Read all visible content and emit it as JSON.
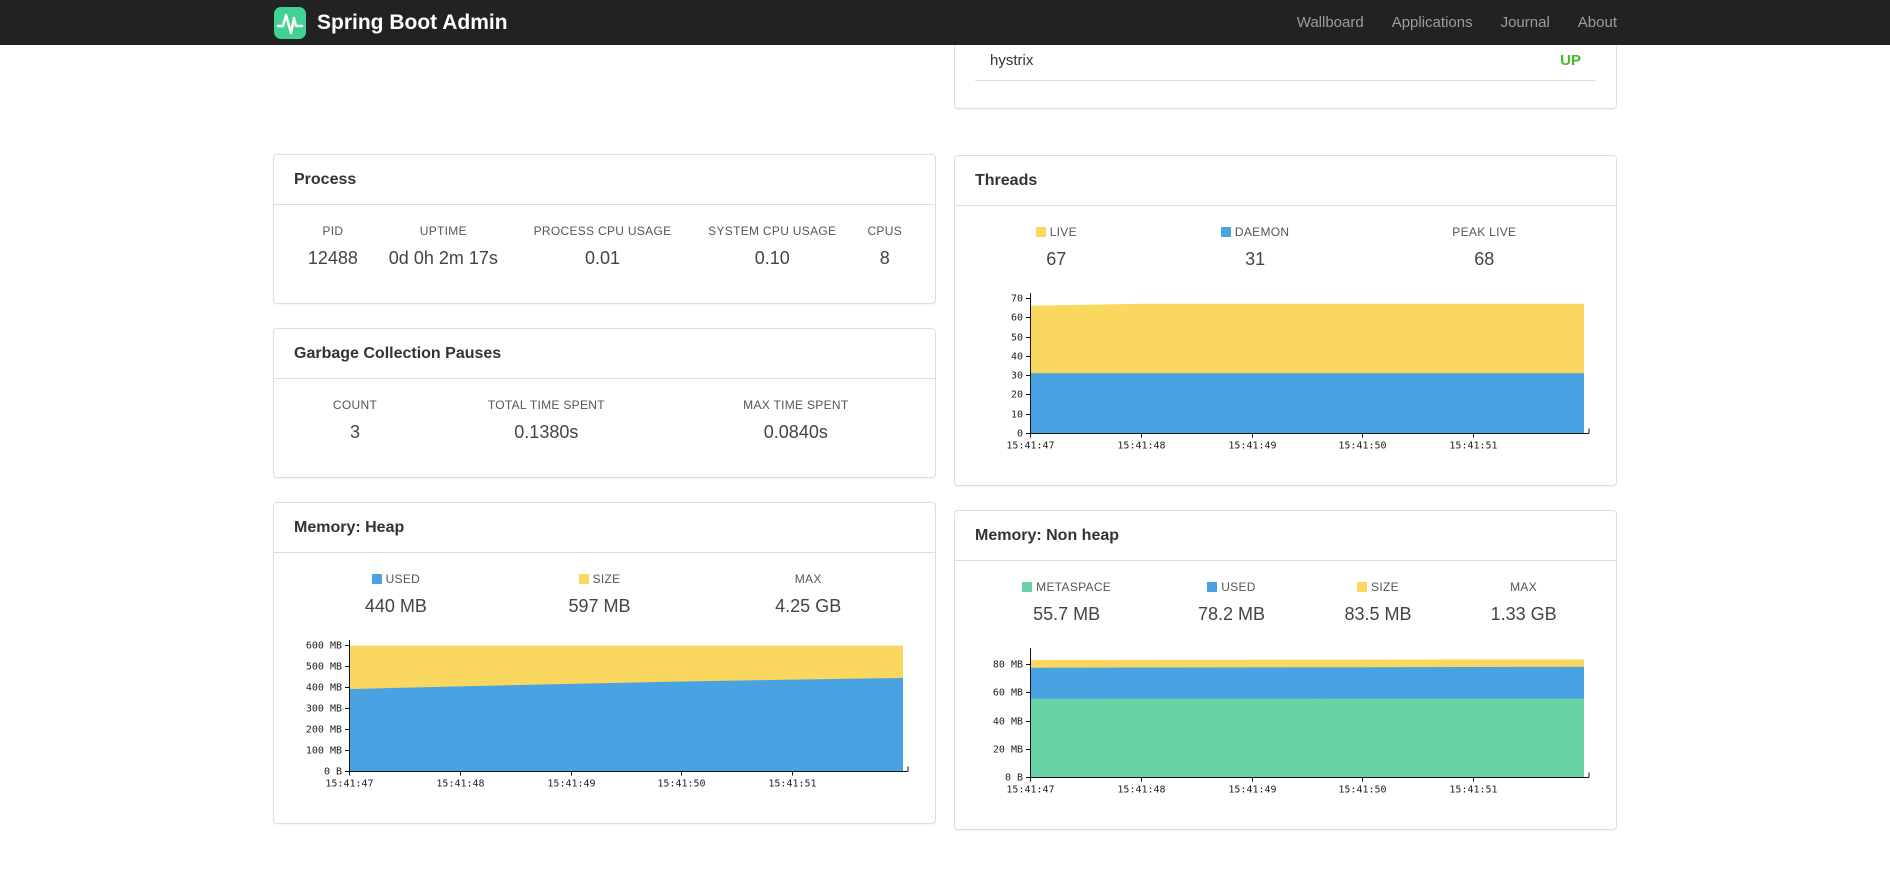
{
  "navbar": {
    "brand": "Spring Boot Admin",
    "links": [
      "Wallboard",
      "Applications",
      "Journal",
      "About"
    ]
  },
  "colors": {
    "up": "#44bb22",
    "chart_yellow": "#fad860",
    "chart_blue": "#49a3e2",
    "chart_green": "#68d3a7",
    "brand_bg": "#40d295"
  },
  "health": {
    "service": "hystrix",
    "status": "UP"
  },
  "panels": {
    "process": {
      "title": "Process",
      "stats": [
        {
          "label": "PID",
          "value": "12488"
        },
        {
          "label": "UPTIME",
          "value": "0d 0h 2m 17s"
        },
        {
          "label": "PROCESS CPU USAGE",
          "value": "0.01"
        },
        {
          "label": "SYSTEM CPU USAGE",
          "value": "0.10"
        },
        {
          "label": "CPUS",
          "value": "8"
        }
      ]
    },
    "gc": {
      "title": "Garbage Collection Pauses",
      "stats": [
        {
          "label": "COUNT",
          "value": "3"
        },
        {
          "label": "TOTAL TIME SPENT",
          "value": "0.1380s"
        },
        {
          "label": "MAX TIME SPENT",
          "value": "0.0840s"
        }
      ]
    },
    "threads": {
      "title": "Threads",
      "stats": [
        {
          "label": "LIVE",
          "value": "67",
          "swatch": "#fad860"
        },
        {
          "label": "DAEMON",
          "value": "31",
          "swatch": "#49a3e2"
        },
        {
          "label": "PEAK LIVE",
          "value": "68"
        }
      ]
    },
    "heap": {
      "title": "Memory: Heap",
      "stats": [
        {
          "label": "USED",
          "value": "440 MB",
          "swatch": "#49a3e2"
        },
        {
          "label": "SIZE",
          "value": "597 MB",
          "swatch": "#fad860"
        },
        {
          "label": "MAX",
          "value": "4.25 GB"
        }
      ]
    },
    "nonheap": {
      "title": "Memory: Non heap",
      "stats": [
        {
          "label": "METASPACE",
          "value": "55.7 MB",
          "swatch": "#68d3a7"
        },
        {
          "label": "USED",
          "value": "78.2 MB",
          "swatch": "#49a3e2"
        },
        {
          "label": "SIZE",
          "value": "83.5 MB",
          "swatch": "#fad860"
        },
        {
          "label": "MAX",
          "value": "1.33 GB"
        }
      ]
    }
  },
  "chart_data": [
    {
      "type": "area",
      "title": "Threads",
      "x_labels": [
        "15:41:47",
        "15:41:48",
        "15:41:49",
        "15:41:50",
        "15:41:51"
      ],
      "ylim": [
        0,
        70
      ],
      "grid": false,
      "legend_position": "top",
      "y_ticks": [
        {
          "label": "0",
          "value": 0
        },
        {
          "label": "10",
          "value": 10
        },
        {
          "label": "20",
          "value": 20
        },
        {
          "label": "30",
          "value": 30
        },
        {
          "label": "40",
          "value": 40
        },
        {
          "label": "50",
          "value": 50
        },
        {
          "label": "60",
          "value": 60
        },
        {
          "label": "70",
          "value": 70
        }
      ],
      "series": [
        {
          "name": "LIVE",
          "color": "#fad860",
          "values": [
            66,
            67,
            67,
            67,
            67,
            67
          ]
        },
        {
          "name": "DAEMON",
          "color": "#49a3e2",
          "values": [
            31,
            31,
            31,
            31,
            31,
            31
          ]
        }
      ]
    },
    {
      "type": "area",
      "title": "Memory: Heap (MB)",
      "x_labels": [
        "15:41:47",
        "15:41:48",
        "15:41:49",
        "15:41:50",
        "15:41:51"
      ],
      "ylim": [
        0,
        600
      ],
      "grid": false,
      "legend_position": "top",
      "y_ticks": [
        {
          "label": "0 B",
          "value": 0
        },
        {
          "label": "100 MB",
          "value": 100
        },
        {
          "label": "200 MB",
          "value": 200
        },
        {
          "label": "300 MB",
          "value": 300
        },
        {
          "label": "400 MB",
          "value": 400
        },
        {
          "label": "500 MB",
          "value": 500
        },
        {
          "label": "600 MB",
          "value": 600
        }
      ],
      "series": [
        {
          "name": "SIZE",
          "color": "#fad860",
          "values": [
            597,
            597,
            597,
            597,
            597,
            597
          ]
        },
        {
          "name": "USED",
          "color": "#49a3e2",
          "values": [
            390,
            403,
            415,
            426,
            435,
            443
          ]
        }
      ]
    },
    {
      "type": "area",
      "title": "Memory: Non heap (MB)",
      "x_labels": [
        "15:41:47",
        "15:41:48",
        "15:41:49",
        "15:41:50",
        "15:41:51"
      ],
      "ylim": [
        0,
        88
      ],
      "grid": false,
      "legend_position": "top",
      "y_ticks": [
        {
          "label": "0 B",
          "value": 0
        },
        {
          "label": "20 MB",
          "value": 20
        },
        {
          "label": "40 MB",
          "value": 40
        },
        {
          "label": "60 MB",
          "value": 60
        },
        {
          "label": "80 MB",
          "value": 80
        }
      ],
      "series": [
        {
          "name": "SIZE",
          "color": "#fad860",
          "values": [
            83.0,
            83.1,
            83.2,
            83.3,
            83.4,
            83.5
          ]
        },
        {
          "name": "USED",
          "color": "#49a3e2",
          "values": [
            77.5,
            77.7,
            77.8,
            77.9,
            78.1,
            78.2
          ]
        },
        {
          "name": "METASPACE",
          "color": "#68d3a7",
          "values": [
            55.5,
            55.6,
            55.6,
            55.7,
            55.7,
            55.7
          ]
        }
      ]
    }
  ]
}
